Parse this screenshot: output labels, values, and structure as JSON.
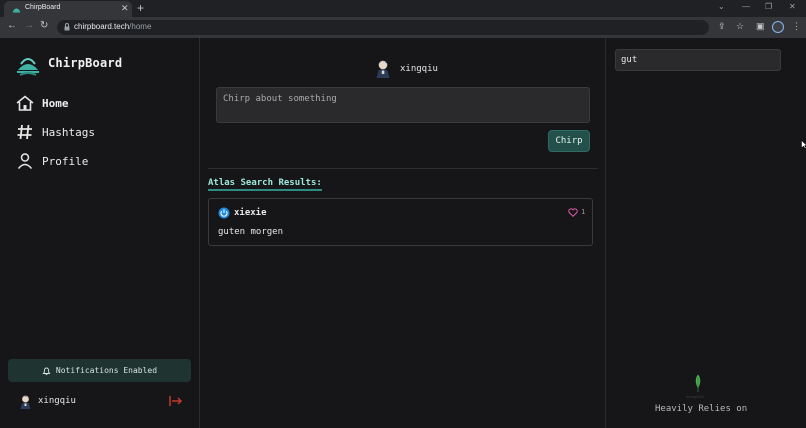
{
  "browser": {
    "tab_title": "ChirpBoard",
    "url_host": "chirpboard.tech",
    "url_path": "/home"
  },
  "app": {
    "brand": "ChirpBoard"
  },
  "sidebar": {
    "items": [
      {
        "label": "Home",
        "icon": "home-icon"
      },
      {
        "label": "Hashtags",
        "icon": "hash-icon"
      },
      {
        "label": "Profile",
        "icon": "user-icon"
      }
    ],
    "notifications": "Notifications Enabled",
    "user": "xingqiu"
  },
  "main": {
    "username": "xingqiu",
    "compose_placeholder": "Chirp about something",
    "chirp_button": "Chirp",
    "results_title": "Atlas Search Results:",
    "results": [
      {
        "user": "xiexie",
        "likes": "1",
        "text": "guten morgen"
      }
    ]
  },
  "right": {
    "search_value": "gut",
    "mongo_wordmark": "mongoDB",
    "relies_text": "Heavily Relies on"
  },
  "colors": {
    "accent": "#2e8b82",
    "button": "#24504c",
    "heart": "#e05fa5",
    "logout": "#c0392b"
  }
}
